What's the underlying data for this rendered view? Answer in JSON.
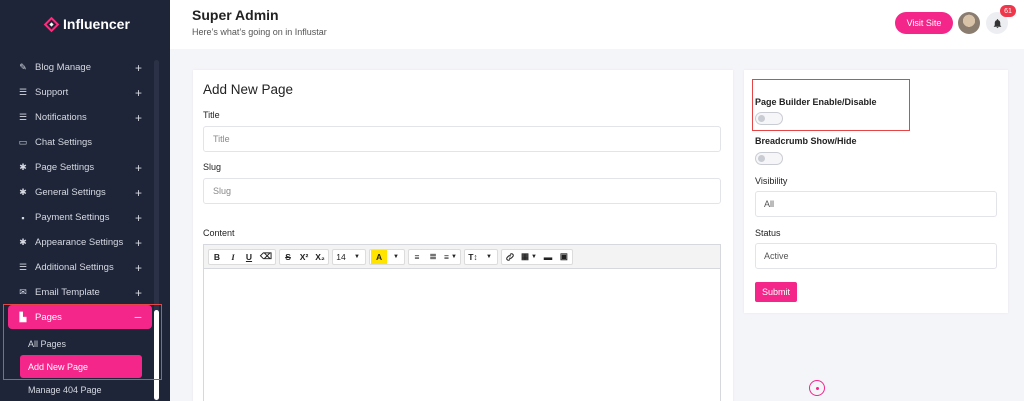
{
  "brand": {
    "name": "Influencer",
    "accent": "#f4268a"
  },
  "sidebar": {
    "items": [
      {
        "label": "Blog Manage",
        "icon": "blog-icon",
        "expandable": true
      },
      {
        "label": "Support",
        "icon": "list-icon",
        "expandable": true
      },
      {
        "label": "Notifications",
        "icon": "list-icon",
        "expandable": true
      },
      {
        "label": "Chat Settings",
        "icon": "chat-icon",
        "expandable": false
      },
      {
        "label": "Page Settings",
        "icon": "gear-icon",
        "expandable": true
      },
      {
        "label": "General Settings",
        "icon": "gear-icon",
        "expandable": true
      },
      {
        "label": "Payment Settings",
        "icon": "briefcase-icon",
        "expandable": true
      },
      {
        "label": "Appearance Settings",
        "icon": "gear-icon",
        "expandable": true
      },
      {
        "label": "Additional Settings",
        "icon": "list-icon",
        "expandable": true
      },
      {
        "label": "Email Template",
        "icon": "mail-icon",
        "expandable": true
      },
      {
        "label": "Pages",
        "icon": "pages-icon",
        "expandable": true,
        "active": true
      }
    ],
    "sub_items": [
      "All Pages",
      "Add New Page",
      "Manage 404 Page"
    ]
  },
  "header": {
    "title": "Super Admin",
    "subtitle": "Here’s what’s going on in Influstar",
    "visit_label": "Visit Site",
    "notification_count": "61"
  },
  "form": {
    "heading": "Add New Page",
    "title_label": "Title",
    "title_placeholder": "Title",
    "slug_label": "Slug",
    "slug_placeholder": "Slug",
    "content_label": "Content",
    "toolbar": {
      "bold": "B",
      "italic": "I",
      "underline": "U",
      "eraser": "⌫",
      "strike": "S",
      "superscript": "X²",
      "subscript": "X₂",
      "font_size": "14",
      "color": "A",
      "ul": "≡",
      "ol": "≣",
      "align": "≡",
      "text_style": "T↕",
      "link": "🔗",
      "table": "▦",
      "hr": "▬",
      "image": "▣"
    }
  },
  "side": {
    "page_builder_label": "Page Builder Enable/Disable",
    "breadcrumb_label": "Breadcrumb Show/Hide",
    "visibility_label": "Visibility",
    "visibility_value": "All",
    "status_label": "Status",
    "status_value": "Active",
    "submit_label": "Submit"
  }
}
